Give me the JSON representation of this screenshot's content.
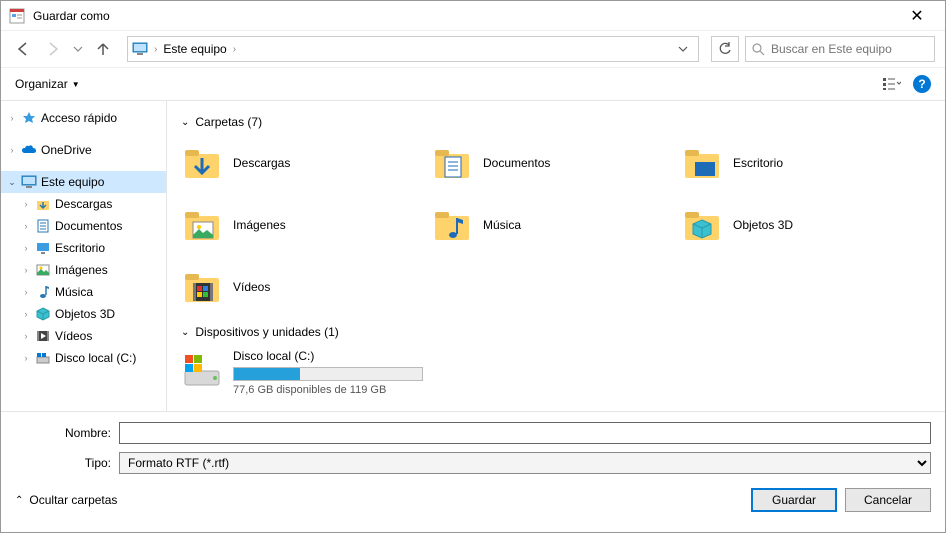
{
  "window": {
    "title": "Guardar como"
  },
  "nav": {
    "location": "Este equipo",
    "search_placeholder": "Buscar en Este equipo"
  },
  "toolbar": {
    "organize": "Organizar"
  },
  "tree": {
    "quick": "Acceso rápido",
    "onedrive": "OneDrive",
    "thispc": "Este equipo",
    "children": [
      "Descargas",
      "Documentos",
      "Escritorio",
      "Imágenes",
      "Música",
      "Objetos 3D",
      "Vídeos",
      "Disco local (C:)"
    ]
  },
  "groups": {
    "folders": {
      "title": "Carpetas (7)",
      "items": [
        "Descargas",
        "Documentos",
        "Escritorio",
        "Imágenes",
        "Música",
        "Objetos 3D",
        "Vídeos"
      ]
    },
    "devices": {
      "title": "Dispositivos y unidades (1)",
      "drive_name": "Disco local (C:)",
      "drive_free": "77,6 GB disponibles de 119 GB",
      "drive_fill_pct": 35
    }
  },
  "form": {
    "name_label": "Nombre:",
    "name_value": "",
    "type_label": "Tipo:",
    "type_value": "Formato RTF (*.rtf)"
  },
  "actions": {
    "hide": "Ocultar carpetas",
    "save": "Guardar",
    "cancel": "Cancelar"
  }
}
